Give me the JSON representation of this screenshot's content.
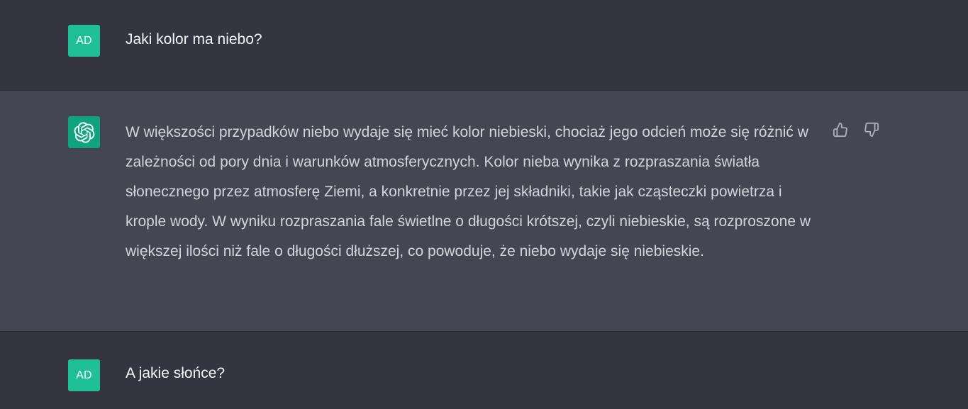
{
  "conversation": {
    "user_initials": "AD",
    "messages": [
      {
        "role": "user",
        "text": "Jaki kolor ma niebo?"
      },
      {
        "role": "assistant",
        "text": "W większości przypadków niebo wydaje się mieć kolor niebieski, chociaż jego odcień może się różnić w zależności od pory dnia i warunków atmosferycznych. Kolor nieba wynika z rozpraszania światła słonecznego przez atmosferę Ziemi, a konkretnie przez jej składniki, takie jak cząsteczki powietrza i krople wody. W wyniku rozpraszania fale świetlne o długości krótszej, czyli niebieskie, są rozproszone w większej ilości niż fale o długości dłuższej, co powoduje, że niebo wydaje się niebieskie."
      },
      {
        "role": "user",
        "text": "A jakie słońce?"
      }
    ]
  },
  "icons": {
    "assistant_avatar": "openai-logo-icon",
    "thumbs_up": "thumbs-up-icon",
    "thumbs_down": "thumbs-down-icon"
  },
  "colors": {
    "background": "#343541",
    "assistant_background": "#444654",
    "user_avatar": "#1fbf97",
    "assistant_avatar": "#10a37f",
    "text": "#d1d5db"
  }
}
